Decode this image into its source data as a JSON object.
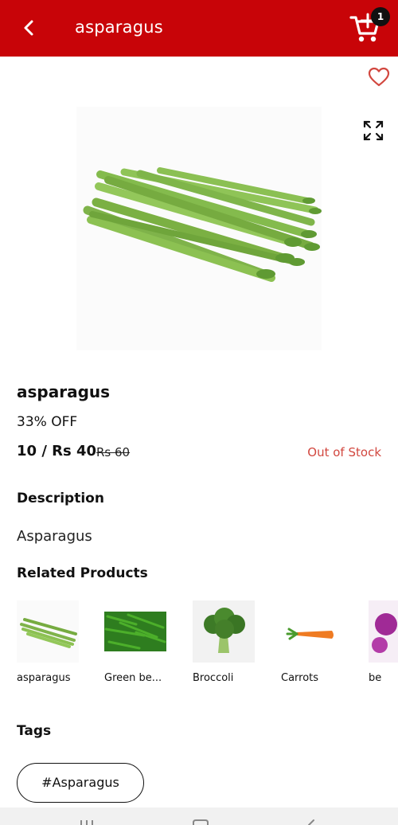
{
  "appbar": {
    "title": "asparagus",
    "cart_count": "1",
    "color": "#c80408"
  },
  "icons": {
    "back": "back-arrow-icon",
    "cart": "cart-add-icon",
    "favorite": "heart-outline-icon",
    "expand": "fullscreen-icon"
  },
  "product": {
    "name": "asparagus",
    "discount": "33% OFF",
    "price": "10 / Rs 40",
    "old_price": "Rs 60",
    "stock_status": "Out of Stock",
    "stock_color": "#d2473f"
  },
  "description": {
    "heading": "Description",
    "text": "Asparagus"
  },
  "related": {
    "heading": "Related Products",
    "items": [
      {
        "label": "asparagus"
      },
      {
        "label": "Green be..."
      },
      {
        "label": "Broccoli"
      },
      {
        "label": "Carrots"
      },
      {
        "label": "be"
      }
    ]
  },
  "tags": {
    "heading": "Tags",
    "items": [
      "#Asparagus"
    ]
  }
}
